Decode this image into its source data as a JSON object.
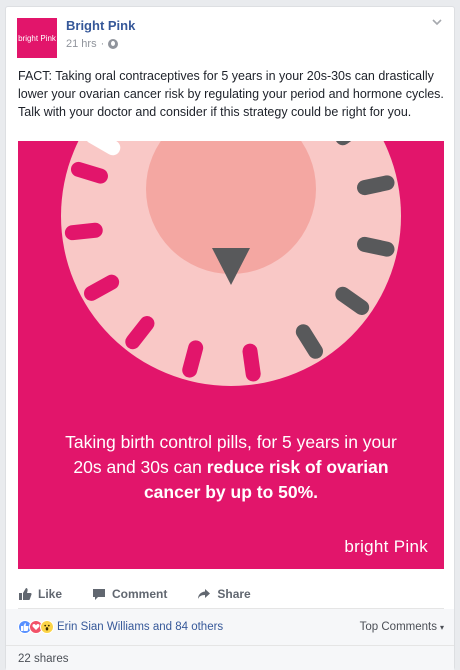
{
  "post": {
    "page_name": "Bright Pink",
    "avatar_text": "bright Pink",
    "time": "21 hrs",
    "dot": "·",
    "text": "FACT: Taking oral contraceptives for 5 years in your 20s-30s can drastically lower your ovarian cancer risk by regulating your period and hormone cycles. Talk with your doctor and consider if this strategy could be right for you."
  },
  "image": {
    "caption_line1": "Taking birth control pills, for 5 years in your",
    "caption_line2_plain": "20s and 30s can ",
    "caption_line2_bold": "reduce risk of ovarian",
    "caption_line3_bold": "cancer by up to 50%.",
    "logo": "bright Pink",
    "colors": {
      "background": "#e2156b",
      "dial_outer": "#f9c8c6",
      "dial_inner": "#f4a7a2",
      "pill_pink": "#e2156b",
      "pill_gray": "#58595b",
      "pill_white": "#ffffff"
    }
  },
  "actions": {
    "like": "Like",
    "comment": "Comment",
    "share": "Share"
  },
  "reactions": {
    "text": "Erin Sian Williams and 84 others",
    "top_comments": "Top Comments",
    "top_comments_arrow": "▾"
  },
  "shares": {
    "text": "22 shares"
  },
  "icons": {
    "avatar": "bright-pink-logo",
    "globe": "globe-icon",
    "chevron": "chevron-down-icon",
    "like": "thumbs-up-icon",
    "comment": "comment-icon",
    "share": "share-arrow-icon"
  }
}
